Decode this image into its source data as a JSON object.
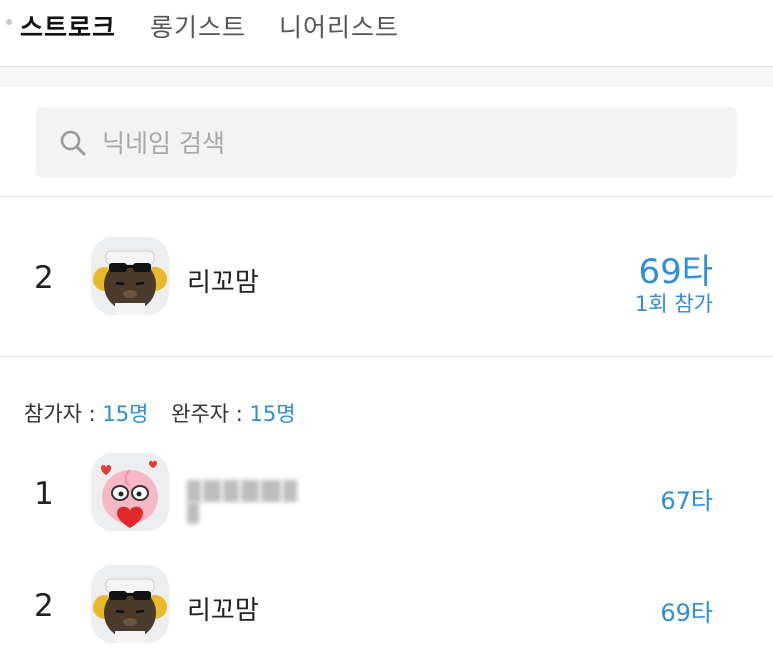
{
  "tabs": [
    {
      "label": "스트로크",
      "active": true
    },
    {
      "label": "롱기스트",
      "active": false
    },
    {
      "label": "니어리스트",
      "active": false
    }
  ],
  "search": {
    "placeholder": "닉네임 검색",
    "icon": "search-icon"
  },
  "my_record": {
    "rank": "2",
    "name": "리꼬맘",
    "score": "69타",
    "participation": "1회 참가",
    "avatar": "ryan-avatar"
  },
  "stats": {
    "participants_label": "참가자 : ",
    "participants_value": "15명",
    "finishers_label": "완주자 : ",
    "finishers_value": "15명"
  },
  "leaderboard": [
    {
      "rank": "1",
      "name": "",
      "name_blurred": true,
      "score": "67타",
      "avatar": "apeach-avatar"
    },
    {
      "rank": "2",
      "name": "리꼬맘",
      "score": "69타",
      "avatar": "ryan-avatar"
    }
  ],
  "colors": {
    "accent": "#2f8fd8",
    "divider": "#e3e3e3",
    "search_bg": "#f3f3f3"
  }
}
